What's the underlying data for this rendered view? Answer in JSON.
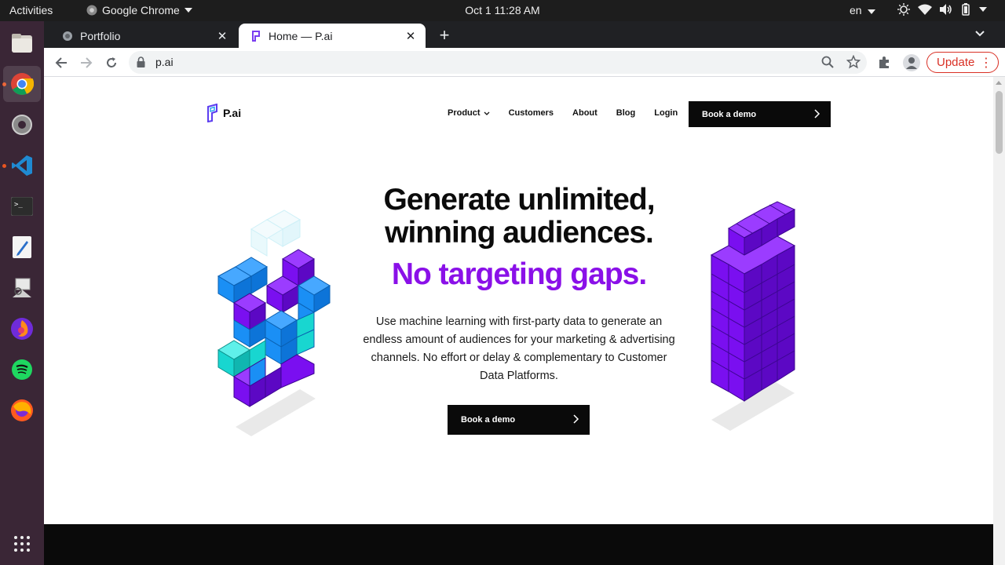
{
  "system_bar": {
    "activities": "Activities",
    "app_name": "Google Chrome",
    "clock": "Oct 1  11:28 AM",
    "language": "en"
  },
  "dock": {
    "items": [
      "files-icon",
      "chrome-icon",
      "settings-icon",
      "vscode-icon",
      "terminal-icon",
      "text-editor-icon",
      "screenshot-tool-icon",
      "firefox-dev-icon",
      "spotify-icon",
      "firefox-icon",
      "app-grid-icon"
    ]
  },
  "browser": {
    "tabs": [
      {
        "title": "Portfolio",
        "active": false
      },
      {
        "title": "Home — P.ai",
        "active": true
      }
    ],
    "url": "p.ai",
    "update_label": "Update"
  },
  "site": {
    "logo_text": "P.ai",
    "nav": {
      "product": "Product",
      "customers": "Customers",
      "about": "About",
      "blog": "Blog",
      "login": "Login"
    },
    "nav_cta": "Book a demo",
    "hero": {
      "headline_line1": "Generate unlimited,",
      "headline_line2": "winning audiences.",
      "subheadline": "No targeting gaps.",
      "description": "Use machine learning with first-party data to generate an endless amount of audiences for your marketing & advertising channels. No effort or delay & complementary to Customer Data Platforms.",
      "cta": "Book a demo"
    },
    "colors": {
      "accent_purple": "#8a10e8",
      "cube_purple": "#7a0ff0",
      "cube_blue": "#1a8ff5",
      "cube_cyan": "#18d6d0",
      "cta_black": "#0a0a0a"
    }
  }
}
